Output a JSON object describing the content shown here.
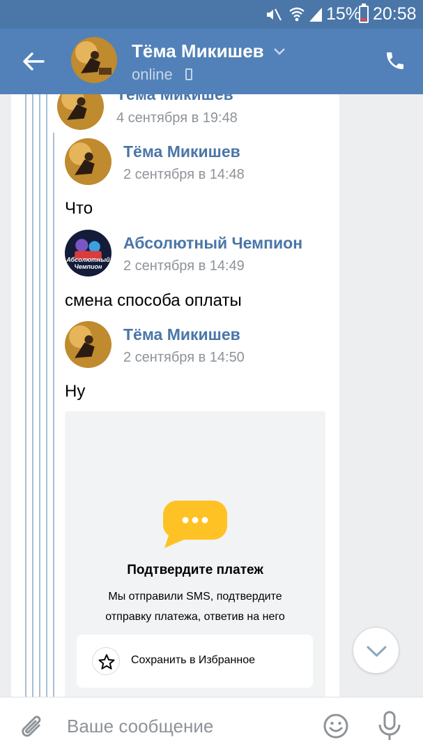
{
  "status_bar": {
    "battery": "15%",
    "time": "20:58"
  },
  "header": {
    "name": "Тёма Микишев",
    "status": "online"
  },
  "messages": [
    {
      "author": "Тёма Микишев",
      "time": "4 сентября в 19:48"
    },
    {
      "author": "Тёма Микишев",
      "time": "2 сентября в 14:48",
      "text": "Что"
    },
    {
      "author": "Абсолютный Чемпион",
      "avatar_caption": "Абсолютный Чемпион",
      "time": "2 сентября в 14:49",
      "text": "смена способа оплаты"
    },
    {
      "author": "Тёма Микишев",
      "time": "2 сентября в 14:50",
      "text": "Ну"
    }
  ],
  "card": {
    "title": "Подтвердите платеж",
    "description": "Мы отправили SMS, подтвердите отправку платежа, ответив на него",
    "button_label": "Сохранить в Избранное"
  },
  "input": {
    "placeholder": "Ваше сообщение"
  },
  "colors": {
    "header": "#5181b8",
    "status_bar": "#4a76a8",
    "author": "#4a76a8",
    "thread_line": "#a8bed6",
    "card_icon": "#ffc225"
  },
  "icons": [
    "mute-icon",
    "wifi-icon",
    "signal-icon",
    "battery-icon",
    "back-arrow-icon",
    "chevron-down-icon",
    "phone-icon",
    "call-icon",
    "chat-bubble-icon",
    "star-icon",
    "scroll-down-icon",
    "attach-icon",
    "emoji-icon",
    "mic-icon"
  ]
}
